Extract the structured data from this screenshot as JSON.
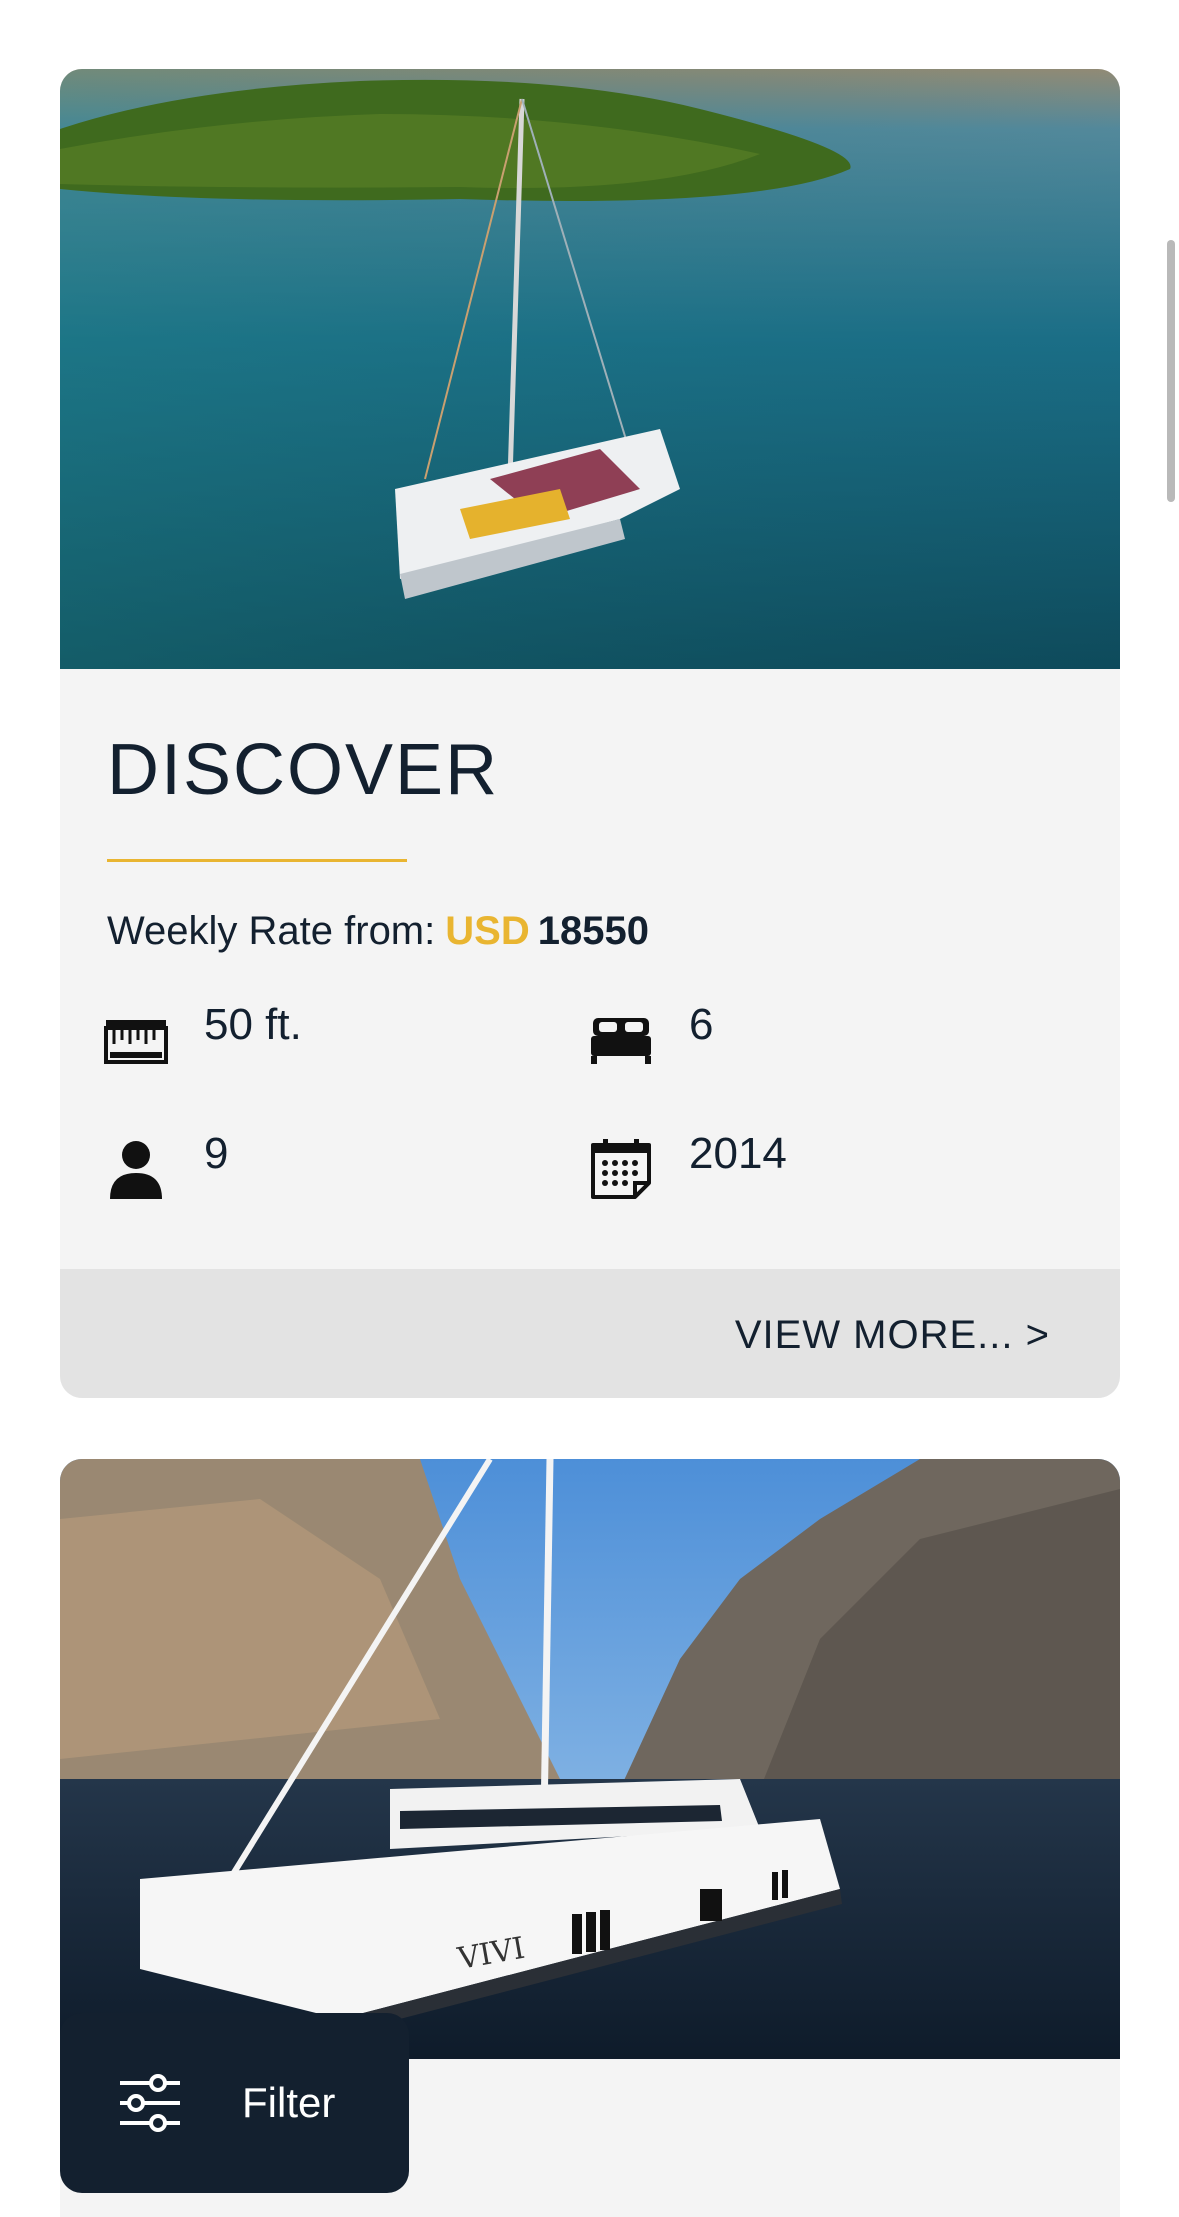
{
  "listings": [
    {
      "name": "DISCOVER",
      "rate_label": "Weekly Rate from:",
      "currency": "USD",
      "amount": "18550",
      "length": "50 ft.",
      "cabins": "6",
      "guests": "9",
      "year": "2014",
      "view_more": "VIEW MORE... >",
      "icons": [
        "ruler-icon",
        "bed-icon",
        "person-icon",
        "calendar-icon"
      ]
    },
    {
      "hull_lettering": "VIVI"
    }
  ],
  "filter": {
    "label": "Filter",
    "icon": "sliders-icon"
  },
  "colors": {
    "accent": "#e9b531",
    "navy": "#13202f",
    "card_bg": "#f4f4f4",
    "bar_bg": "#e3e3e3"
  }
}
